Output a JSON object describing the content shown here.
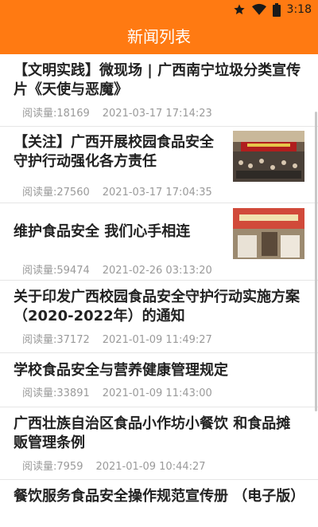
{
  "status_bar": {
    "time": "3:18",
    "icons": [
      "star-icon",
      "wifi-icon",
      "battery-icon"
    ]
  },
  "app_bar": {
    "title": "新闻列表"
  },
  "colors": {
    "accent": "#ff7a12",
    "meta_text": "#9a9a9a",
    "title_text": "#222222"
  },
  "news": [
    {
      "title": "【文明实践】微现场 | 广西南宁垃圾分类宣传片《天使与恶魔》",
      "read_label": "阅读量:18169",
      "date": "2021-03-17 17:14:23",
      "has_thumbnail": false
    },
    {
      "title": "【关注】广西开展校园食品安全守护行动强化各方责任",
      "read_label": "阅读量:27560",
      "date": "2021-03-17 17:04:35",
      "has_thumbnail": true
    },
    {
      "title": "维护食品安全 我们心手相连",
      "read_label": "阅读量:59474",
      "date": "2021-02-26 03:13:20",
      "has_thumbnail": true
    },
    {
      "title": "关于印发广西校园食品安全守护行动实施方案（2020-2022年）的通知",
      "read_label": "阅读量:37172",
      "date": "2021-01-09 11:49:27",
      "has_thumbnail": false
    },
    {
      "title": "学校食品安全与营养健康管理规定",
      "read_label": "阅读量:33891",
      "date": "2021-01-09 11:43:00",
      "has_thumbnail": false
    },
    {
      "title": "广西壮族自治区食品小作坊小餐饮 和食品摊贩管理条例",
      "read_label": "阅读量:7959",
      "date": "2021-01-09 10:44:27",
      "has_thumbnail": false
    },
    {
      "title": "餐饮服务食品安全操作规范宣传册 （电子版）",
      "has_thumbnail": false
    }
  ]
}
